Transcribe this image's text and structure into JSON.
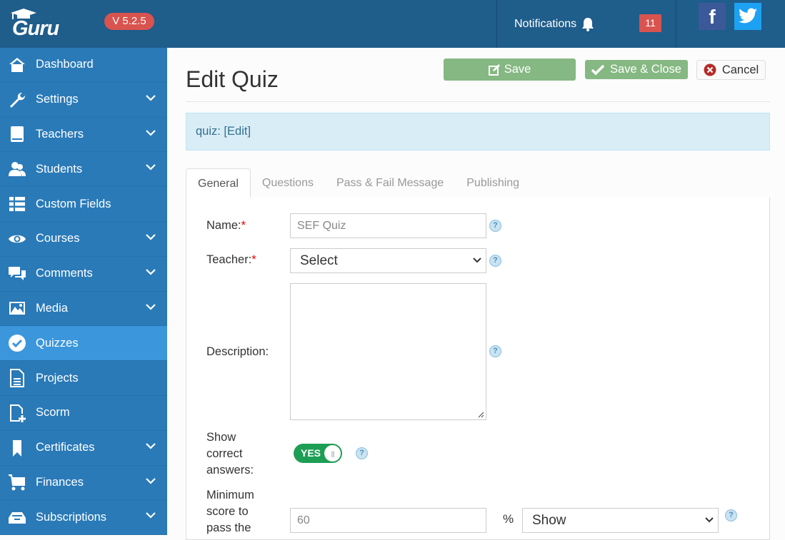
{
  "header": {
    "logo_text": "Guru",
    "version": "V 5.2.5",
    "notifications_label": "Notifications",
    "notifications_count": "11",
    "social": {
      "facebook": "f"
    }
  },
  "sidebar": {
    "items": [
      {
        "label": "Dashboard",
        "icon": "home-icon",
        "expandable": false,
        "active": false
      },
      {
        "label": "Settings",
        "icon": "wrench-icon",
        "expandable": true,
        "active": false
      },
      {
        "label": "Teachers",
        "icon": "book-icon",
        "expandable": true,
        "active": false
      },
      {
        "label": "Students",
        "icon": "users-icon",
        "expandable": true,
        "active": false
      },
      {
        "label": "Custom Fields",
        "icon": "list-icon",
        "expandable": false,
        "active": false
      },
      {
        "label": "Courses",
        "icon": "eye-icon",
        "expandable": true,
        "active": false
      },
      {
        "label": "Comments",
        "icon": "comments-icon",
        "expandable": true,
        "active": false
      },
      {
        "label": "Media",
        "icon": "image-icon",
        "expandable": true,
        "active": false
      },
      {
        "label": "Quizzes",
        "icon": "check-circle-icon",
        "expandable": false,
        "active": true
      },
      {
        "label": "Projects",
        "icon": "file-text-icon",
        "expandable": false,
        "active": false
      },
      {
        "label": "Scorm",
        "icon": "file-plus-icon",
        "expandable": false,
        "active": false
      },
      {
        "label": "Certificates",
        "icon": "bookmark-icon",
        "expandable": true,
        "active": false
      },
      {
        "label": "Finances",
        "icon": "cart-icon",
        "expandable": true,
        "active": false
      },
      {
        "label": "Subscriptions",
        "icon": "inbox-icon",
        "expandable": true,
        "active": false
      }
    ]
  },
  "page": {
    "title": "Edit Quiz",
    "buttons": {
      "save": "Save",
      "save_close": "Save & Close",
      "cancel": "Cancel"
    },
    "info_bar": "quiz: [Edit]",
    "tabs": [
      "General",
      "Questions",
      "Pass & Fail Message",
      "Publishing"
    ],
    "active_tab": "General"
  },
  "form": {
    "name": {
      "label": "Name:",
      "required": "*",
      "value": "SEF Quiz"
    },
    "teacher": {
      "label": "Teacher:",
      "required": "*",
      "selected": "Select"
    },
    "description": {
      "label": "Description:",
      "value": ""
    },
    "show_correct": {
      "label_lines": [
        "Show",
        "correct",
        "answers:"
      ],
      "toggle_text": "YES",
      "value": true
    },
    "min_score": {
      "label_lines": [
        "Minimum",
        "score to",
        "pass the"
      ],
      "value": "60",
      "unit": "%",
      "visibility_selected": "Show"
    },
    "help_glyph": "?"
  },
  "colors": {
    "topbar": "#1f5d8b",
    "sidebar": "#2a7ab8",
    "sidebar_active": "#3b96dc",
    "badge_red": "#d9534f",
    "button_green": "#85b882",
    "toggle_green": "#1e9e55",
    "info_bg": "#d9edf7"
  }
}
